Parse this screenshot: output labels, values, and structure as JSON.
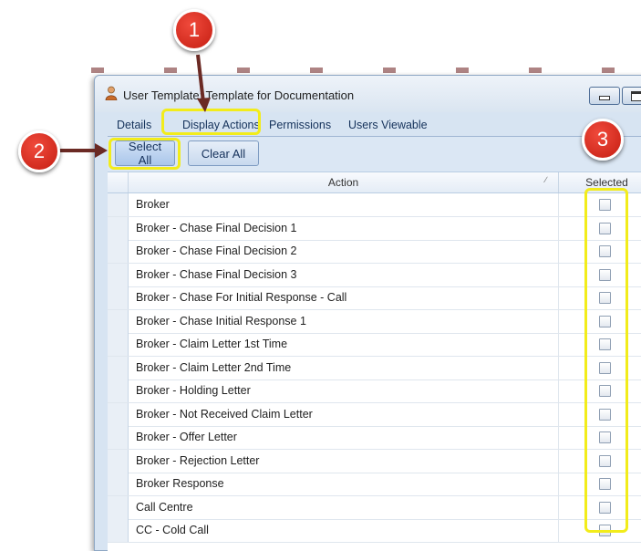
{
  "window": {
    "title": "User Template: Template for Documentation"
  },
  "tabs": [
    {
      "label": "Details"
    },
    {
      "label": "Display Actions"
    },
    {
      "label": "Permissions"
    },
    {
      "label": "Users Viewable"
    }
  ],
  "toolbar": {
    "select_all_label": "Select All",
    "clear_all_label": "Clear All"
  },
  "grid": {
    "columns": {
      "action": "Action",
      "selected": "Selected"
    },
    "rows": [
      {
        "action": "Broker",
        "selected": false
      },
      {
        "action": "Broker - Chase Final Decision 1",
        "selected": false
      },
      {
        "action": "Broker - Chase Final Decision 2",
        "selected": false
      },
      {
        "action": "Broker - Chase Final Decision 3",
        "selected": false
      },
      {
        "action": "Broker - Chase For Initial Response - Call",
        "selected": false
      },
      {
        "action": "Broker - Chase Initial Response 1",
        "selected": false
      },
      {
        "action": "Broker - Claim Letter 1st Time",
        "selected": false
      },
      {
        "action": "Broker - Claim Letter 2nd Time",
        "selected": false
      },
      {
        "action": "Broker - Holding Letter",
        "selected": false
      },
      {
        "action": "Broker - Not Received Claim Letter",
        "selected": false
      },
      {
        "action": "Broker - Offer Letter",
        "selected": false
      },
      {
        "action": "Broker - Rejection Letter",
        "selected": false
      },
      {
        "action": "Broker Response",
        "selected": false
      },
      {
        "action": "Call Centre",
        "selected": false
      },
      {
        "action": "CC - Cold Call",
        "selected": false
      }
    ]
  },
  "annotations": {
    "callout_1": "1",
    "callout_2": "2",
    "callout_3": "3",
    "color": "#d32a1e",
    "highlight_color": "#f2ec1b"
  }
}
